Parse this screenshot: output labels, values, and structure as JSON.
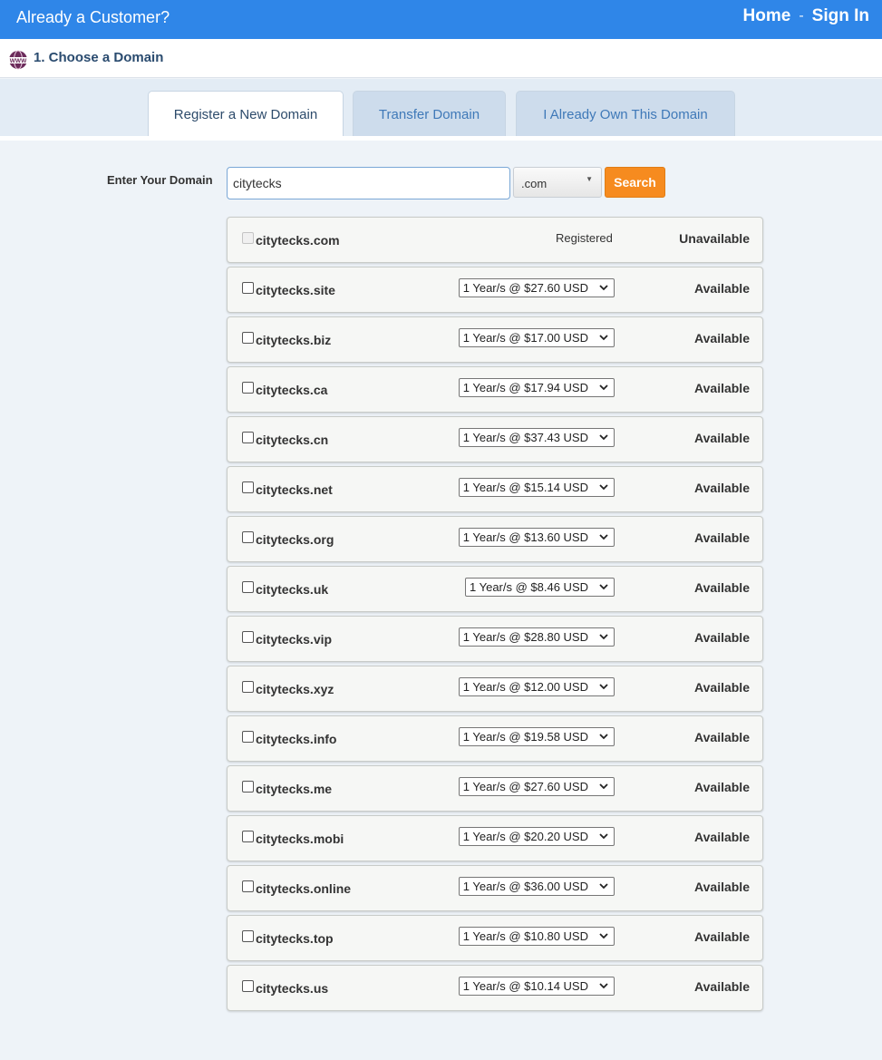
{
  "topbar": {
    "title": "Already a Customer?",
    "home": "Home",
    "separator": "-",
    "signin": "Sign In"
  },
  "step": {
    "title": "1. Choose a Domain",
    "icon": "www-globe-icon"
  },
  "tabs": [
    {
      "label": "Register a New Domain",
      "active": true
    },
    {
      "label": "Transfer Domain",
      "active": false
    },
    {
      "label": "I Already Own This Domain",
      "active": false
    }
  ],
  "search": {
    "label": "Enter Your Domain",
    "value": "citytecks",
    "tld": ".com",
    "button": "Search"
  },
  "results": [
    {
      "domain": "citytecks.com",
      "price": "",
      "registered": "Registered",
      "status": "Unavailable"
    },
    {
      "domain": "citytecks.site",
      "price": "1 Year/s @ $27.60 USD",
      "status": "Available"
    },
    {
      "domain": "citytecks.biz",
      "price": "1 Year/s @ $17.00 USD",
      "status": "Available"
    },
    {
      "domain": "citytecks.ca",
      "price": "1 Year/s @ $17.94 USD",
      "status": "Available"
    },
    {
      "domain": "citytecks.cn",
      "price": "1 Year/s @ $37.43 USD",
      "status": "Available"
    },
    {
      "domain": "citytecks.net",
      "price": "1 Year/s @ $15.14 USD",
      "status": "Available"
    },
    {
      "domain": "citytecks.org",
      "price": "1 Year/s @ $13.60 USD",
      "status": "Available"
    },
    {
      "domain": "citytecks.uk",
      "price": "1 Year/s @ $8.46 USD",
      "status": "Available"
    },
    {
      "domain": "citytecks.vip",
      "price": "1 Year/s @ $28.80 USD",
      "status": "Available"
    },
    {
      "domain": "citytecks.xyz",
      "price": "1 Year/s @ $12.00 USD",
      "status": "Available"
    },
    {
      "domain": "citytecks.info",
      "price": "1 Year/s @ $19.58 USD",
      "status": "Available"
    },
    {
      "domain": "citytecks.me",
      "price": "1 Year/s @ $27.60 USD",
      "status": "Available"
    },
    {
      "domain": "citytecks.mobi",
      "price": "1 Year/s @ $20.20 USD",
      "status": "Available"
    },
    {
      "domain": "citytecks.online",
      "price": "1 Year/s @ $36.00 USD",
      "status": "Available"
    },
    {
      "domain": "citytecks.top",
      "price": "1 Year/s @ $10.80 USD",
      "status": "Available"
    },
    {
      "domain": "citytecks.us",
      "price": "1 Year/s @ $10.14 USD",
      "status": "Available"
    }
  ],
  "colors": {
    "topbar": "#2f86e8",
    "search_button": "#f68b1f",
    "tab_active_text": "#2d4b6b",
    "tab_inactive_text": "#3f79b8"
  }
}
